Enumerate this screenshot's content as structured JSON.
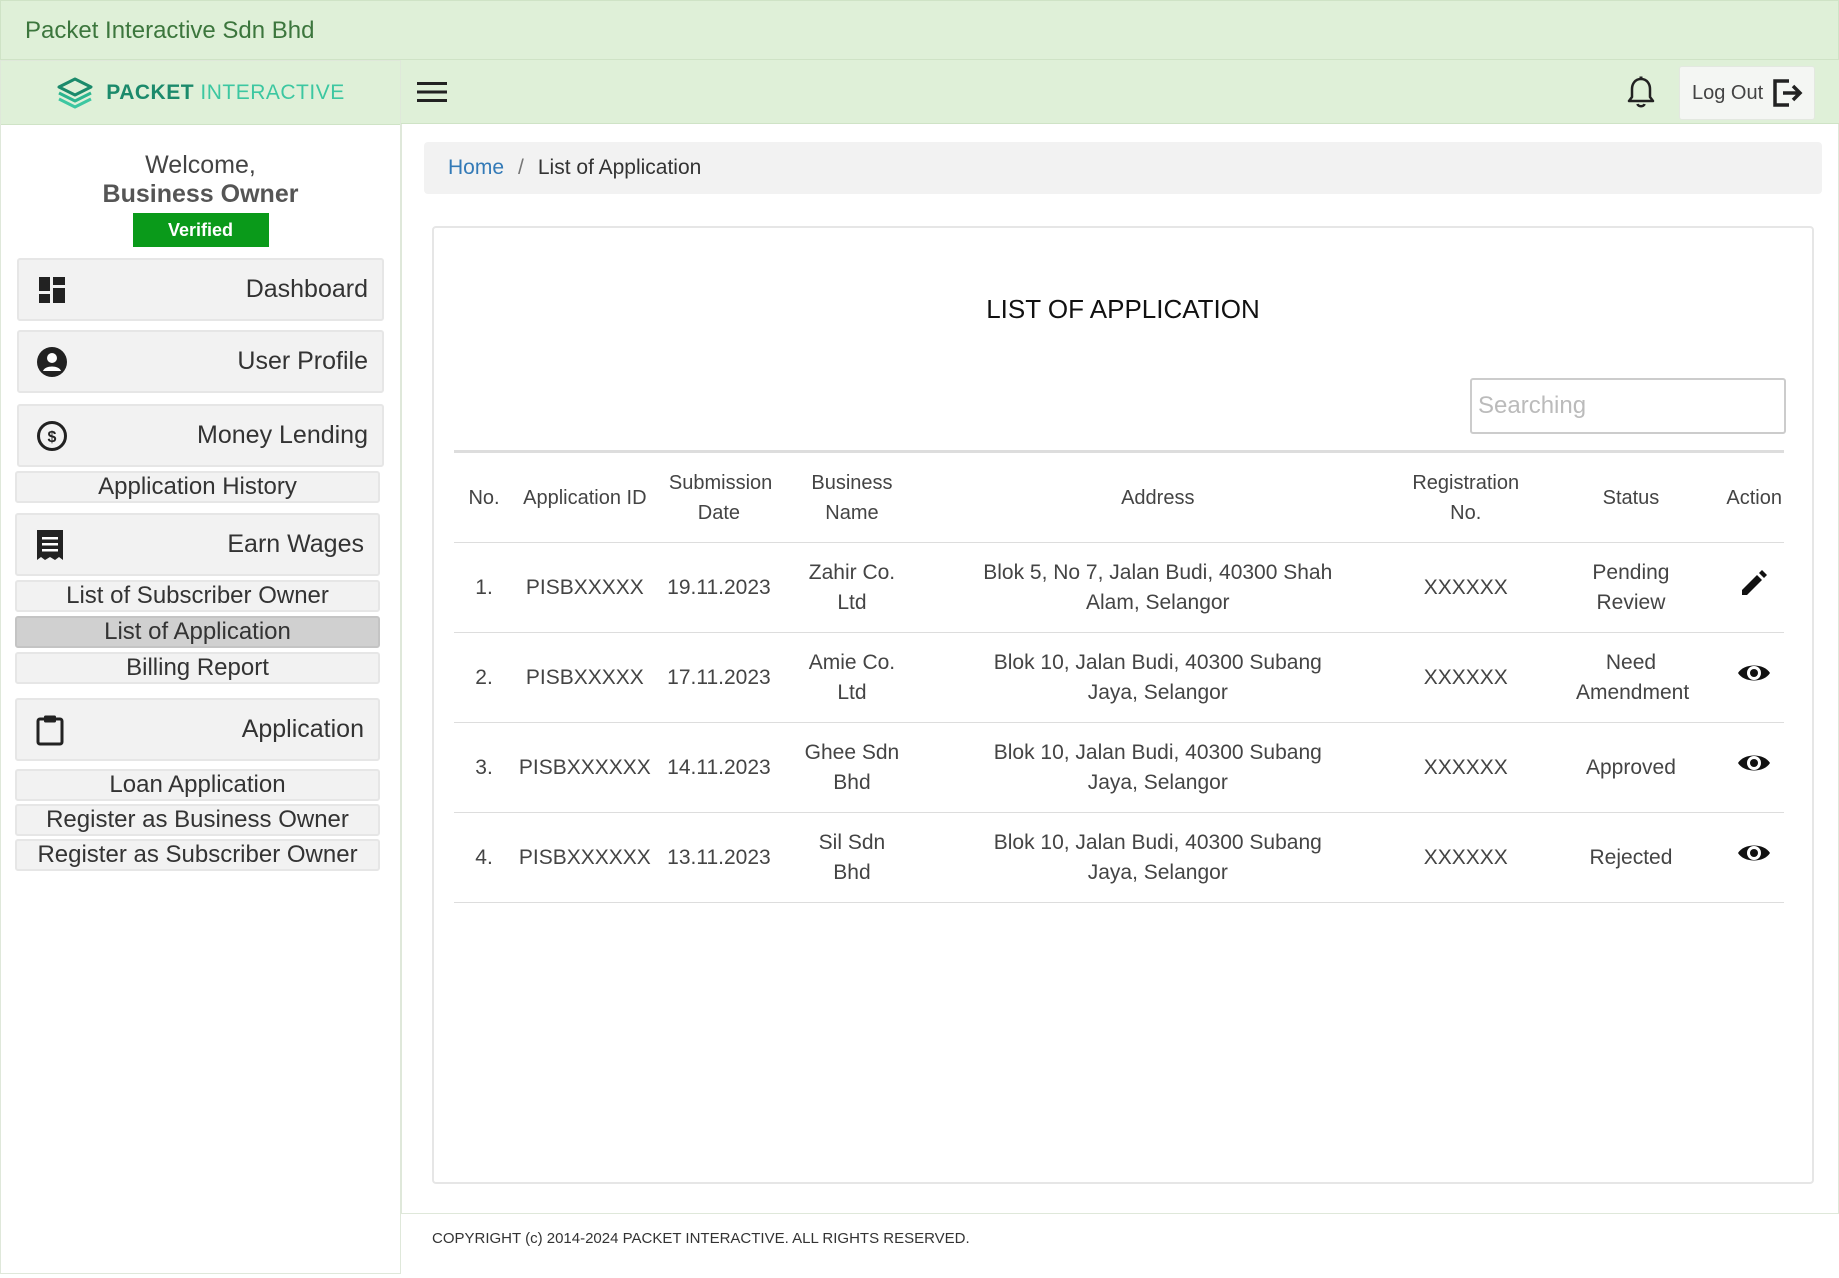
{
  "topbar": {
    "company": "Packet Interactive Sdn Bhd"
  },
  "sidebar": {
    "logo": {
      "bold": "PACKET",
      "light": "INTERACTIVE"
    },
    "welcome": {
      "line1": "Welcome,",
      "line2": "Business Owner",
      "badge": "Verified"
    },
    "nav": {
      "dashboard": "Dashboard",
      "user_profile": "User Profile",
      "money_lending": "Money Lending",
      "application_history": "Application History",
      "earn_wages": "Earn Wages",
      "list_subscriber_owner": "List of Subscriber Owner",
      "list_application": "List of Application",
      "billing_report": "Billing Report",
      "application": "Application",
      "loan_application": "Loan Application",
      "register_business_owner": "Register as Business Owner",
      "register_subscriber_owner": "Register as Subscriber Owner"
    }
  },
  "header": {
    "logout_label": "Log Out"
  },
  "breadcrumb": {
    "home": "Home",
    "separator": "/",
    "current": "List of Application"
  },
  "card": {
    "title": "LIST OF APPLICATION",
    "search_placeholder": "Searching"
  },
  "table": {
    "headers": {
      "no": "No.",
      "app_id": "Application ID",
      "submission_date": "Submission Date",
      "business_name": "Business Name",
      "address": "Address",
      "registration_no": "Registration No.",
      "status": "Status",
      "action": "Action"
    },
    "rows": [
      {
        "no": "1.",
        "app_id": "PISBXXXXX",
        "date": "19.11.2023",
        "business": "Zahir Co. Ltd",
        "address": "Blok 5, No 7, Jalan Budi, 40300 Shah Alam, Selangor",
        "reg": "XXXXXX",
        "status": "Pending Review",
        "action": "edit-icon"
      },
      {
        "no": "2.",
        "app_id": "PISBXXXXX",
        "date": "17.11.2023",
        "business": "Amie Co. Ltd",
        "address": "Blok 10, Jalan Budi, 40300 Subang Jaya, Selangor",
        "reg": "XXXXXX",
        "status": "Need Amendment",
        "action": "eye-icon"
      },
      {
        "no": "3.",
        "app_id": "PISBXXXXXX",
        "date": "14.11.2023",
        "business": "Ghee Sdn Bhd",
        "address": "Blok 10, Jalan Budi, 40300 Subang Jaya, Selangor",
        "reg": "XXXXXX",
        "status": "Approved",
        "action": "eye-icon"
      },
      {
        "no": "4.",
        "app_id": "PISBXXXXXX",
        "date": "13.11.2023",
        "business": "Sil Sdn Bhd",
        "address": "Blok 10, Jalan Budi, 40300 Subang Jaya, Selangor",
        "reg": "XXXXXX",
        "status": "Rejected",
        "action": "eye-icon"
      }
    ]
  },
  "footer": {
    "copyright": "COPYRIGHT (c) 2014-2024 PACKET INTERACTIVE. ALL RIGHTS RESERVED."
  },
  "colors": {
    "header_green": "#dff0d8",
    "brand_text": "#3c763d",
    "verified": "#0a9a1a",
    "link": "#337ab7"
  }
}
